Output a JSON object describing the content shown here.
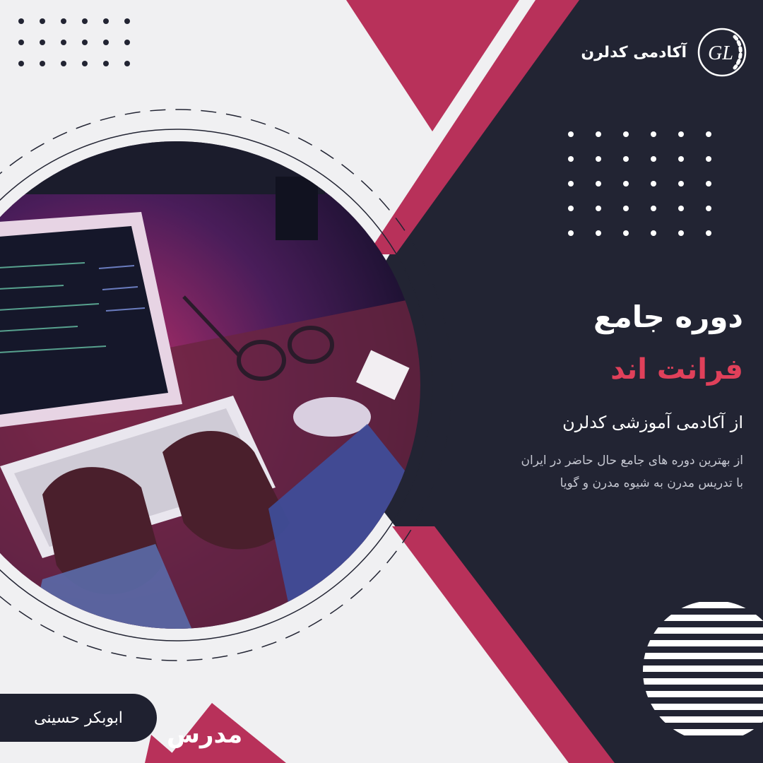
{
  "brand": {
    "name": "آکادمی کدلرن",
    "logo_letters": "GL"
  },
  "headline": {
    "title": "دوره جامع",
    "subject": "فرانت اند",
    "subtitle": "از آکادمی آموزشی کدلرن"
  },
  "description": {
    "line1": "از بهترین دوره های جامع حال حاضر در ایران",
    "line2": "با تدریس مدرن به شیوه مدرن و گویا"
  },
  "instructor": {
    "name": "ابوبکر حسینی",
    "role": "مدرس"
  },
  "colors": {
    "background": "#f0f0f2",
    "dark_panel": "#222433",
    "accent": "#b8315a",
    "accent_text": "#e0405a"
  },
  "photo": {
    "subject": "laptop-keyboard-glasses-photo"
  }
}
